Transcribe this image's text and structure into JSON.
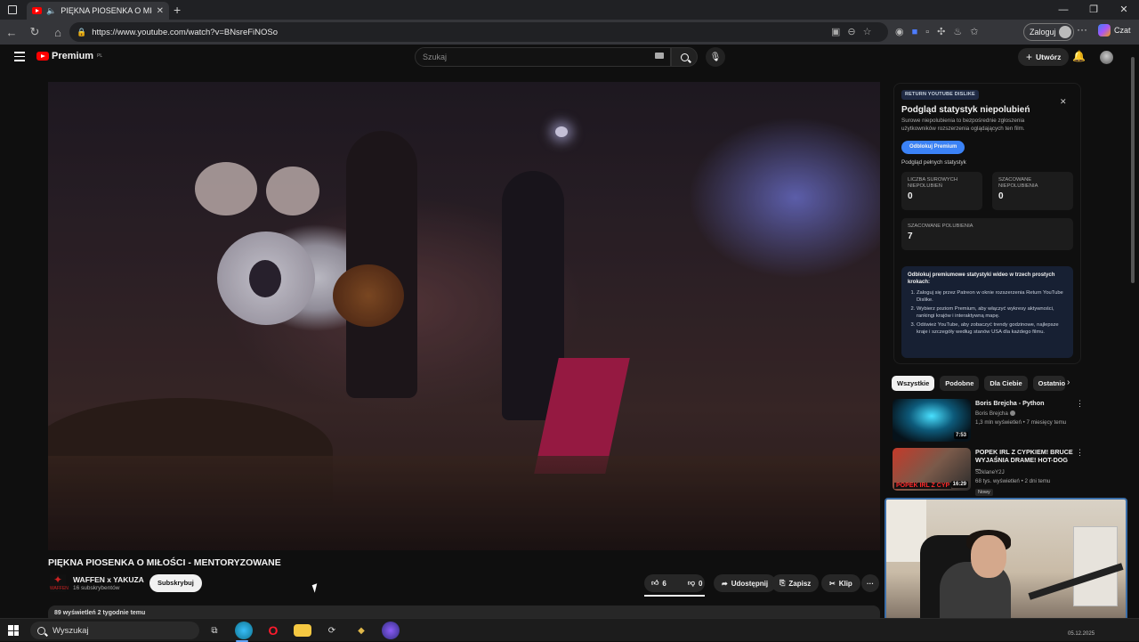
{
  "browser": {
    "tab_title": "PIĘKNA PIOSENKA O MIŁOŚ",
    "url": "https://www.youtube.com/watch?v=BNsreFiNOSo",
    "login_label": "Zaloguj",
    "copilot_label": "Czat"
  },
  "youtube": {
    "logo_text": "Premium",
    "logo_region": "PL",
    "search_placeholder": "Szukaj",
    "create_label": "Utwórz"
  },
  "video": {
    "title": "PIĘKNA PIOSENKA O MIŁOŚCI - MENTORYZOWANE",
    "channel_name": "WAFFEN x YAKUZA",
    "channel_logo_text": "WAFFEN",
    "subscribers": "16 subskrybentów",
    "subscribe_label": "Subskrybuj",
    "like_count": "6",
    "dislike_count": "0",
    "share_label": "Udostępnij",
    "save_label": "Zapisz",
    "clip_label": "Klip",
    "description_stub": "89 wyświetleń  2 tygodnie temu"
  },
  "ryd": {
    "badge": "RETURN YOUTUBE DISLIKE",
    "title": "Podgląd statystyk niepolubień",
    "description": "Surowe niepolubienia to bezpośrednie zgłoszenia użytkowników rozszerzenia oglądających ten film.",
    "unlock_label": "Odblokuj Premium",
    "full_stats_label": "Podgląd pełnych statystyk",
    "stats": [
      {
        "label": "LICZBA SUROWYCH NIEPOLUBIEŃ",
        "value": "0"
      },
      {
        "label": "SZACOWANE NIEPOLUBIENIA",
        "value": "0"
      },
      {
        "label": "SZACOWANE POLUBIENIA",
        "value": "7"
      }
    ],
    "steps_heading": "Odblokuj premiumowe statystyki wideo w trzech prostych krokach:",
    "steps": [
      "Zaloguj się przez Patreon w oknie rozszerzenia Return YouTube Dislike.",
      "Wybierz poziom Premium, aby włączyć wykresy aktywności, rankingi krajów i interaktywną mapę.",
      "Odśwież YouTube, aby zobaczyć trendy godzinowe, najlepsze kraje i szczegóły według stanów USA dla każdego filmu."
    ]
  },
  "chips": [
    "Wszystkie",
    "Podobne",
    "Dla Ciebie",
    "Ostatnio"
  ],
  "recommendations": [
    {
      "title": "Boris Brejcha - Python",
      "channel": "Boris Brejcha",
      "meta": "1,3 mln wyświetleń • 7 miesięcy temu",
      "duration": "7:53"
    },
    {
      "title": "POPEK IRL Z CYPKIEM! BRUCE WYJAŚNIA DRAME! HOT-DOG ...",
      "channel": "SzklaneY2J",
      "meta": "68 tys. wyświetleń • 2 dni temu",
      "duration": "16:29",
      "badge": "Nowy",
      "thumb_text": "POPEK IRL Z CYP"
    }
  ],
  "taskbar": {
    "search_label": "Wyszukaj",
    "clock": "05.12.2025"
  }
}
